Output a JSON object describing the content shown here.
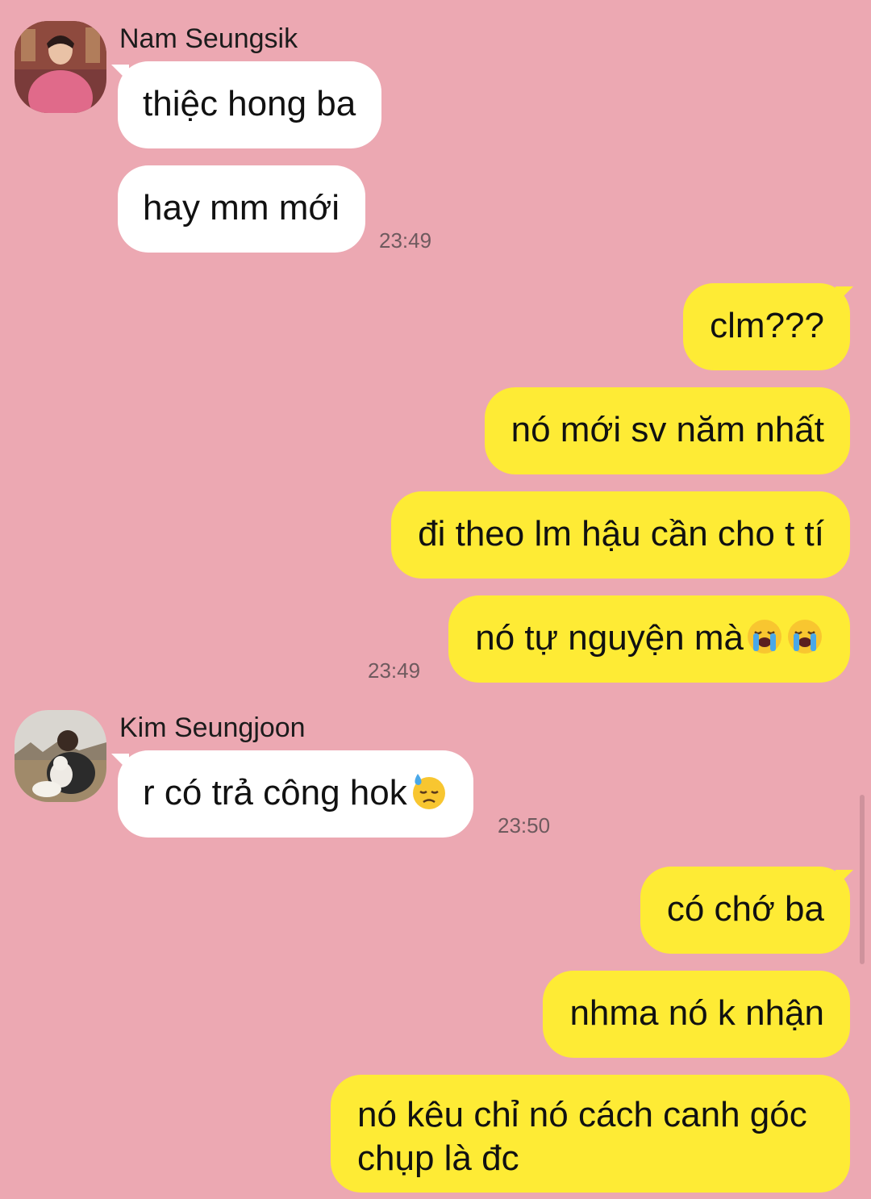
{
  "colors": {
    "background": "#ECA8B2",
    "incoming_bubble": "#FFFFFF",
    "outgoing_bubble": "#FEEB35"
  },
  "groups": [
    {
      "sender": "Nam Seungsik",
      "messages": [
        "thiệc hong ba",
        "hay mm mới"
      ],
      "time": "23:49"
    },
    {
      "outgoing": true,
      "messages": [
        "clm???",
        "nó mới sv năm nhất",
        "đi theo lm hậu cần cho t tí",
        "nó tự nguyện mà"
      ],
      "emoji": [
        "loudly-crying-face-icon",
        "loudly-crying-face-icon"
      ],
      "time": "23:49"
    },
    {
      "sender": "Kim Seungjoon",
      "messages": [
        "r có trả công hok"
      ],
      "emoji": [
        "downcast-face-with-sweat-icon"
      ],
      "time": "23:50"
    },
    {
      "outgoing": true,
      "messages": [
        "có chớ ba",
        "nhma nó k nhận",
        "nó kêu chỉ nó cách canh góc chụp là đc"
      ]
    }
  ]
}
